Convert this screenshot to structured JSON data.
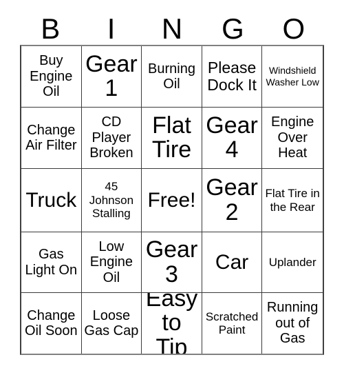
{
  "card": {
    "title_letters": [
      "B",
      "I",
      "N",
      "G",
      "O"
    ],
    "columns": 5,
    "rows": 5,
    "free_space_label": "Free!",
    "border_color": "#3a3a3a",
    "background_color": "#ffffff",
    "text_color": "#000000",
    "cells": [
      {
        "text": "Buy Engine Oil",
        "size": "sm"
      },
      {
        "text": "Gear 1",
        "size": "xl"
      },
      {
        "text": "Burning Oil",
        "size": "sm"
      },
      {
        "text": "Please Dock It",
        "size": "md"
      },
      {
        "text": "Windshield Washer Low",
        "size": "xxs"
      },
      {
        "text": "Change Air Filter",
        "size": "sm"
      },
      {
        "text": "CD Player Broken",
        "size": "sm"
      },
      {
        "text": "Flat Tire",
        "size": "xl"
      },
      {
        "text": "Gear 4",
        "size": "xl"
      },
      {
        "text": "Engine Over Heat",
        "size": "sm"
      },
      {
        "text": "Truck",
        "size": "lg"
      },
      {
        "text": "45 Johnson Stalling",
        "size": "xs"
      },
      {
        "text": "Free!",
        "size": "lg"
      },
      {
        "text": "Gear 2",
        "size": "xl"
      },
      {
        "text": "Flat Tire in the Rear",
        "size": "xs"
      },
      {
        "text": "Gas Light On",
        "size": "sm"
      },
      {
        "text": "Low Engine Oil",
        "size": "sm"
      },
      {
        "text": "Gear 3",
        "size": "xl"
      },
      {
        "text": "Car",
        "size": "lg"
      },
      {
        "text": "Uplander",
        "size": "xs"
      },
      {
        "text": "Change Oil Soon",
        "size": "sm"
      },
      {
        "text": "Loose Gas Cap",
        "size": "sm"
      },
      {
        "text": "Easy to Tip",
        "size": "xl"
      },
      {
        "text": "Scratched Paint",
        "size": "xs"
      },
      {
        "text": "Running out of Gas",
        "size": "sm"
      }
    ]
  }
}
